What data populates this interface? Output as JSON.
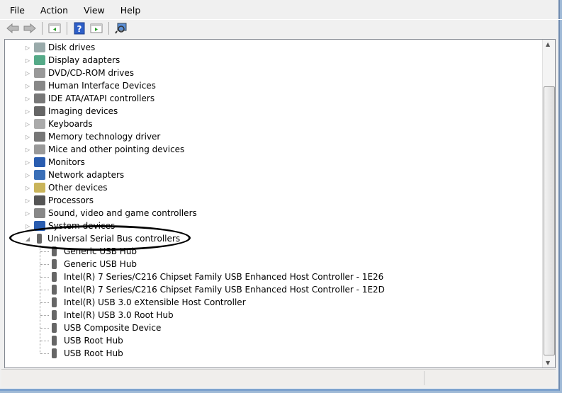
{
  "menu": [
    "File",
    "Action",
    "View",
    "Help"
  ],
  "toolbar": [
    "back-icon",
    "forward-icon",
    "show-hide-console-tree-icon",
    "help-icon",
    "properties-icon",
    "scan-hardware-icon"
  ],
  "categories": [
    {
      "label": "Disk drives",
      "icon": "disk-drive-icon"
    },
    {
      "label": "Display adapters",
      "icon": "display-adapter-icon"
    },
    {
      "label": "DVD/CD-ROM drives",
      "icon": "dvd-icon"
    },
    {
      "label": "Human Interface Devices",
      "icon": "hid-icon"
    },
    {
      "label": "IDE ATA/ATAPI controllers",
      "icon": "ide-icon"
    },
    {
      "label": "Imaging devices",
      "icon": "camera-icon"
    },
    {
      "label": "Keyboards",
      "icon": "keyboard-icon"
    },
    {
      "label": "Memory technology driver",
      "icon": "memory-icon"
    },
    {
      "label": "Mice and other pointing devices",
      "icon": "mouse-icon"
    },
    {
      "label": "Monitors",
      "icon": "monitor-icon"
    },
    {
      "label": "Network adapters",
      "icon": "network-icon"
    },
    {
      "label": "Other devices",
      "icon": "unknown-device-icon"
    },
    {
      "label": "Processors",
      "icon": "processor-icon"
    },
    {
      "label": "Sound, video and game controllers",
      "icon": "speaker-icon"
    },
    {
      "label": "System devices",
      "icon": "system-icon"
    },
    {
      "label": "Universal Serial Bus controllers",
      "icon": "usb-icon",
      "expanded": true
    }
  ],
  "usb_children": [
    "Generic USB Hub",
    "Generic USB Hub",
    "Intel(R) 7 Series/C216 Chipset Family USB Enhanced Host Controller - 1E26",
    "Intel(R) 7 Series/C216 Chipset Family USB Enhanced Host Controller - 1E2D",
    "Intel(R) USB 3.0 eXtensible Host Controller",
    "Intel(R) USB 3.0 Root Hub",
    "USB Composite Device",
    "USB Root Hub",
    "USB Root Hub"
  ],
  "annotation": {
    "shape": "hand-drawn oval",
    "color": "#000000",
    "highlights": "Universal Serial Bus controllers"
  }
}
